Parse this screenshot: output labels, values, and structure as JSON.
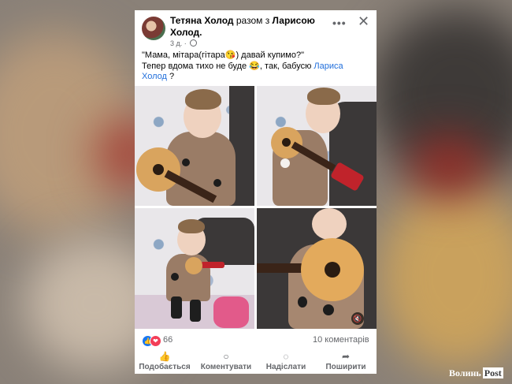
{
  "post": {
    "author": "Тетяна Холод",
    "with_text": "разом з",
    "tagged": "Ларисою Холод",
    "time": "3 д.",
    "text_line1": "\"Мама, мітара(гітара😘) давай купимо?\"",
    "text_line2_prefix": "Тепер вдома тихо не буде 😂, так, бабусю",
    "mention": "Лариса Холод",
    "text_line2_suffix": "?"
  },
  "header": {
    "more_symbol": "•••",
    "close_symbol": "✕"
  },
  "stats": {
    "reactions": "66",
    "comments": "10 коментарів"
  },
  "actions": {
    "like": "Подобається",
    "comment": "Коментувати",
    "send": "Надіслати",
    "share": "Поширити"
  },
  "icons": {
    "like": "like-icon",
    "love": "love-icon",
    "comment": "comment-icon",
    "send": "messenger-icon",
    "share": "share-icon",
    "mute": "speaker-muted-icon",
    "globe": "globe-icon"
  },
  "colors": {
    "facebook_blue": "#1877f2",
    "love_red": "#f33e58",
    "mention_blue": "#216fdb",
    "secondary_text": "#65676b"
  },
  "watermark": {
    "left": "Волинь",
    "right": "Post"
  }
}
